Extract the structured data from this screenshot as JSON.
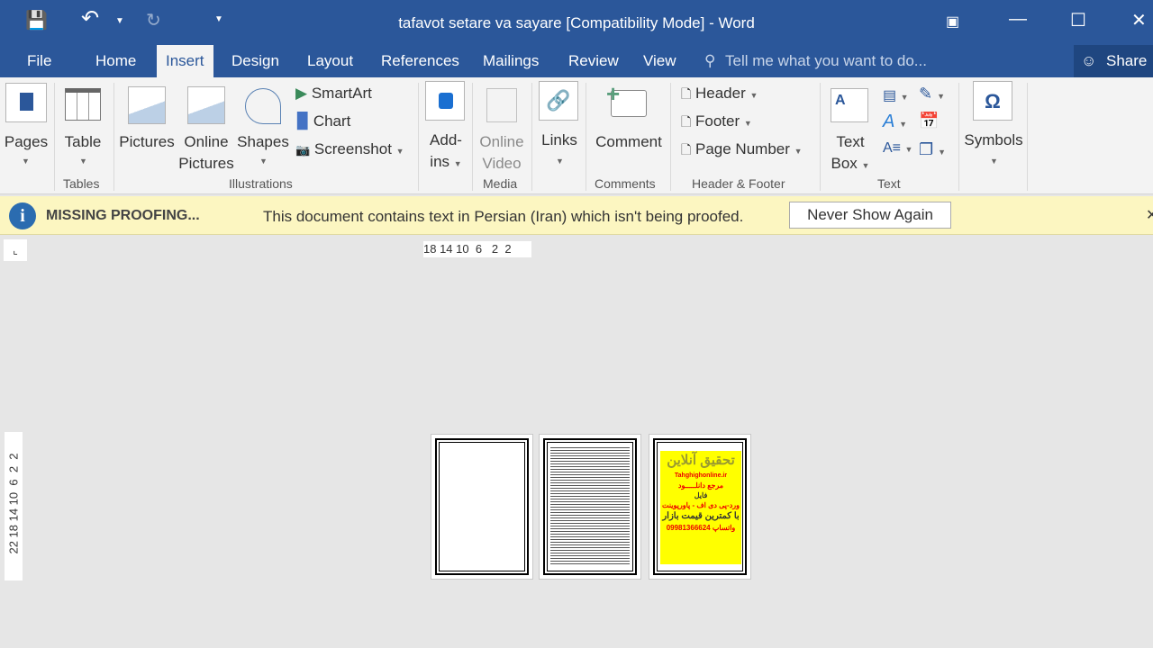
{
  "title": "tafavot setare va sayare [Compatibility Mode] - Word",
  "tabs": [
    "File",
    "Home",
    "Insert",
    "Design",
    "Layout",
    "References",
    "Mailings",
    "Review",
    "View"
  ],
  "tell_me": "Tell me what you want to do...",
  "share": "Share",
  "ribbon": {
    "pages": "Pages",
    "table": "Table",
    "pictures": "Pictures",
    "online_pictures": [
      "Online",
      "Pictures"
    ],
    "shapes": "Shapes",
    "smartart": "SmartArt",
    "chart": "Chart",
    "screenshot": "Screenshot",
    "addins": [
      "Add-",
      "ins"
    ],
    "online_video": [
      "Online",
      "Video"
    ],
    "links": "Links",
    "comment": "Comment",
    "header": "Header",
    "footer": "Footer",
    "page_number": "Page Number",
    "text_box": [
      "Text",
      "Box"
    ],
    "symbols": "Symbols",
    "groups": {
      "tables": "Tables",
      "illustrations": "Illustrations",
      "media": "Media",
      "comments": "Comments",
      "header_footer": "Header & Footer",
      "text": "Text"
    }
  },
  "infobar": {
    "title": "MISSING PROOFING...",
    "message": "This document contains text in Persian (Iran) which isn't being proofed.",
    "button": "Never Show Again"
  },
  "ruler_h": "18 14 10  6   2  2",
  "ruler_v": "22 18 14 10  6  2  2",
  "ad": {
    "title": "تحقیق آنلاین",
    "site": "Tahghighonline.ir",
    "l1": "مرجع دانلـــــود",
    "l2": "فایل",
    "l3": "ورد-پی دی اف - پاورپوینت",
    "l4": "با کمترین قیمت بازار",
    "phone": "09981366624",
    "l5": "واتساپ"
  },
  "colors": {
    "brand": "#2b579a",
    "infobar": "#fcf6c1",
    "ad_bg": "#ffff00"
  }
}
